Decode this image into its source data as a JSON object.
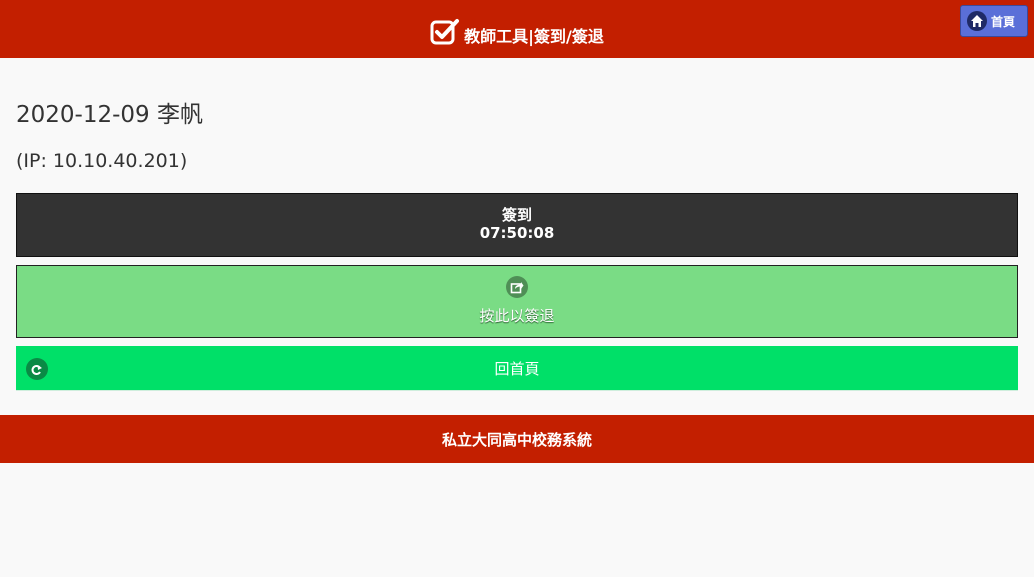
{
  "header": {
    "title": "教師工具|簽到/簽退",
    "icon": "checkbox-checked-icon",
    "home_button_label": "首頁",
    "home_icon": "home-icon"
  },
  "user": {
    "date_name": "2020-12-09 李帆",
    "ip_text": "(IP: 10.10.40.201)"
  },
  "checkin": {
    "label": "簽到",
    "time": "07:50:08"
  },
  "checkout": {
    "label": "按此以簽退",
    "icon": "share-icon"
  },
  "back": {
    "label": "回首頁",
    "icon": "redo-arrow-icon"
  },
  "footer": {
    "text": "私立大同高中校務系統"
  },
  "colors": {
    "header_bg": "#c31f00",
    "checkin_bg": "#333333",
    "checkout_bg": "#7adc85",
    "back_bg": "#00e068",
    "home_btn_bg": "#5a6fd8"
  }
}
